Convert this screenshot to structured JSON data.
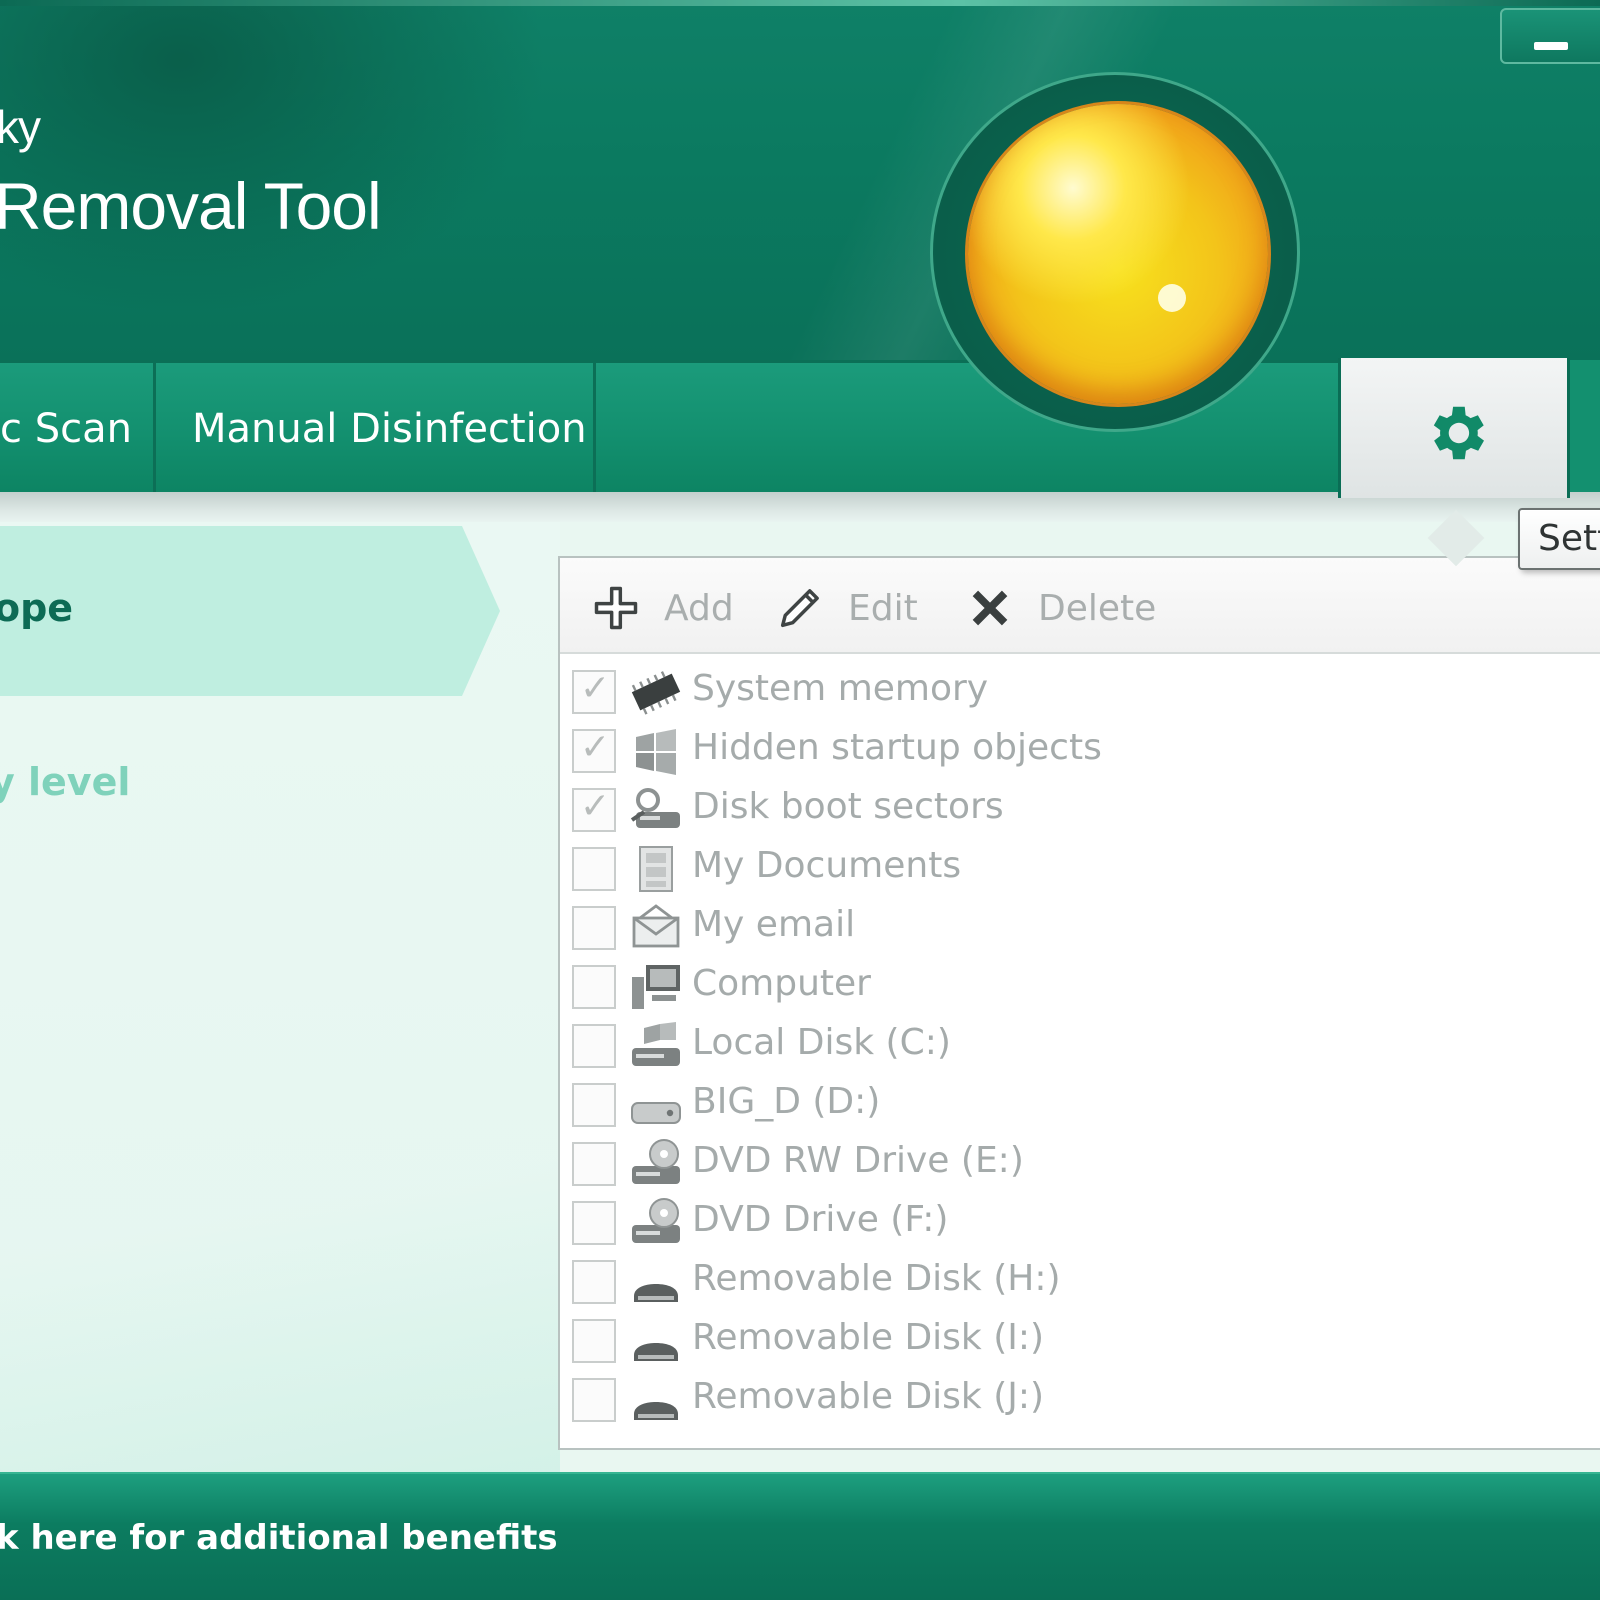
{
  "app": {
    "brand_line1": "ky",
    "brand_line2": "Removal Tool"
  },
  "status_indicator": {
    "state_color": "#f3c41a"
  },
  "tabs": [
    {
      "label": "c Scan"
    },
    {
      "label": "Manual Disinfection"
    }
  ],
  "settings_tab": {
    "icon": "gear-icon",
    "tooltip": "Sett"
  },
  "left_nav": {
    "items": [
      {
        "label": "ope",
        "active": true
      },
      {
        "label": "y level",
        "active": false
      }
    ]
  },
  "toolbar": {
    "add_label": "Add",
    "edit_label": "Edit",
    "delete_label": "Delete"
  },
  "scan_scope": {
    "items": [
      {
        "label": "System memory",
        "checked": true,
        "icon": "memory-chip-icon"
      },
      {
        "label": "Hidden startup objects",
        "checked": true,
        "icon": "windows-flag-icon"
      },
      {
        "label": "Disk boot sectors",
        "checked": true,
        "icon": "boot-sector-icon"
      },
      {
        "label": "My Documents",
        "checked": false,
        "icon": "documents-cabinet-icon"
      },
      {
        "label": "My email",
        "checked": false,
        "icon": "email-envelope-icon"
      },
      {
        "label": "Computer",
        "checked": false,
        "icon": "computer-icon"
      },
      {
        "label": "Local Disk (C:)",
        "checked": false,
        "icon": "system-disk-icon"
      },
      {
        "label": "BIG_D (D:)",
        "checked": false,
        "icon": "hard-disk-icon"
      },
      {
        "label": "DVD RW Drive (E:)",
        "checked": false,
        "icon": "dvd-drive-icon"
      },
      {
        "label": "DVD Drive (F:)",
        "checked": false,
        "icon": "dvd-drive-icon"
      },
      {
        "label": "Removable Disk (H:)",
        "checked": false,
        "icon": "removable-disk-icon"
      },
      {
        "label": "Removable Disk (I:)",
        "checked": false,
        "icon": "removable-disk-icon"
      },
      {
        "label": "Removable Disk (J:)",
        "checked": false,
        "icon": "removable-disk-icon"
      }
    ]
  },
  "footer": {
    "link_label": "k here for additional benefits"
  },
  "colors": {
    "header_green": "#0f8067",
    "tab_green": "#13906f",
    "active_nav": "#bfeee0",
    "orb_yellow": "#f3c41a"
  }
}
